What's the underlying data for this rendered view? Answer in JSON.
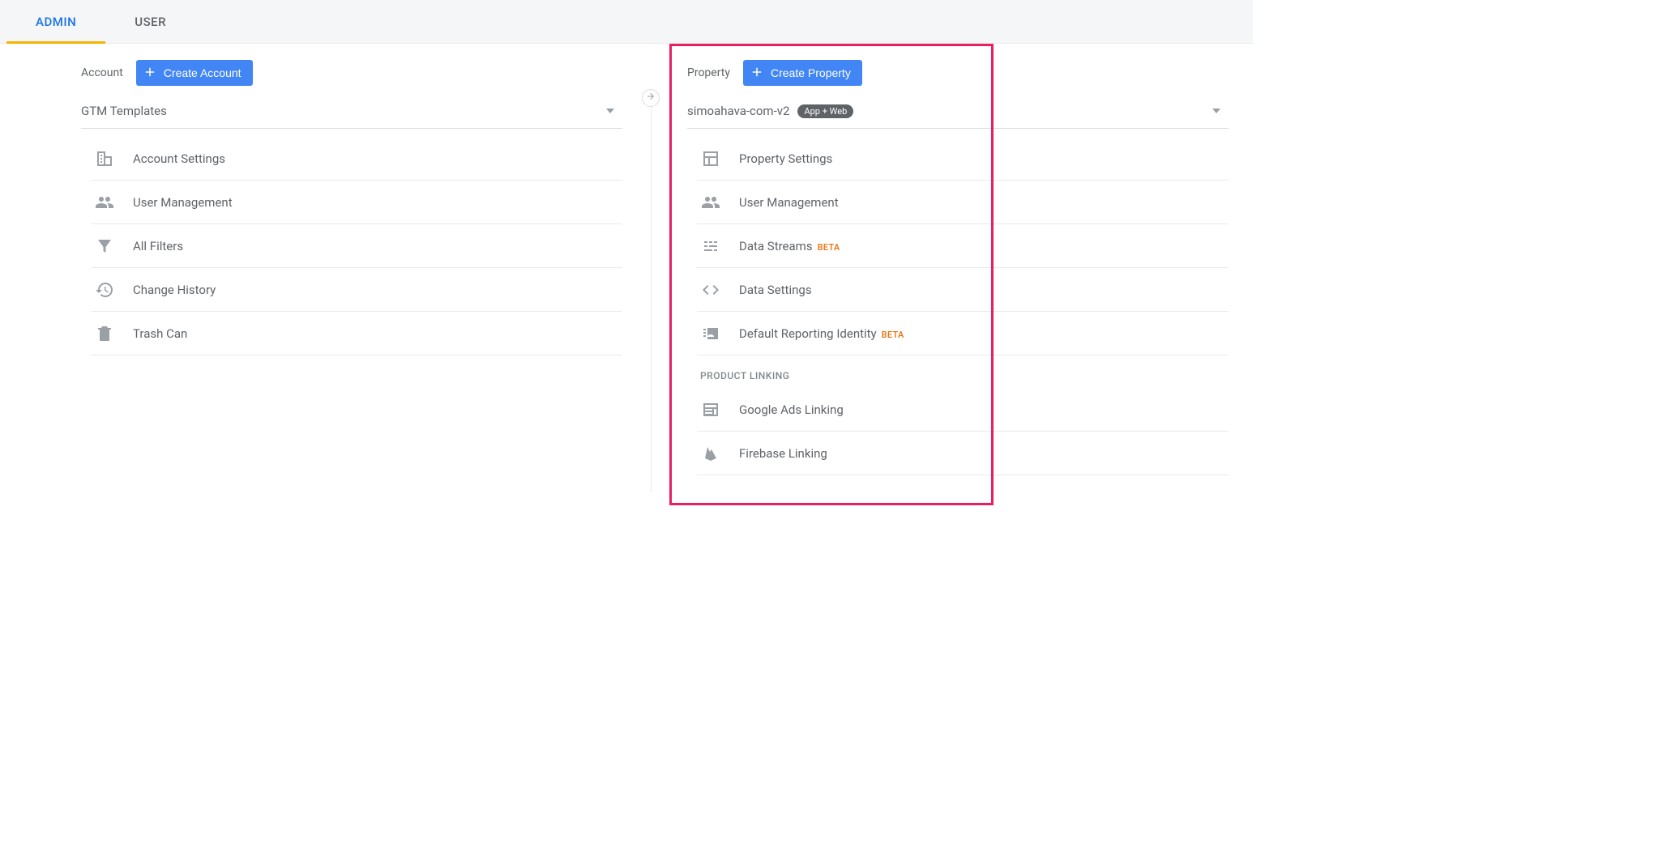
{
  "tabs": {
    "admin": "ADMIN",
    "user": "USER"
  },
  "account": {
    "label": "Account",
    "create": "Create Account",
    "selected": "GTM Templates",
    "items": [
      {
        "label": "Account Settings"
      },
      {
        "label": "User Management"
      },
      {
        "label": "All Filters"
      },
      {
        "label": "Change History"
      },
      {
        "label": "Trash Can"
      }
    ]
  },
  "property": {
    "label": "Property",
    "create": "Create Property",
    "selected": "simoahava-com-v2",
    "badge": "App + Web",
    "items": [
      {
        "label": "Property Settings"
      },
      {
        "label": "User Management"
      },
      {
        "label": "Data Streams",
        "beta": "BETA"
      },
      {
        "label": "Data Settings"
      },
      {
        "label": "Default Reporting Identity",
        "beta": "BETA"
      }
    ],
    "section": "PRODUCT LINKING",
    "linking": [
      {
        "label": "Google Ads Linking"
      },
      {
        "label": "Firebase Linking"
      }
    ]
  }
}
